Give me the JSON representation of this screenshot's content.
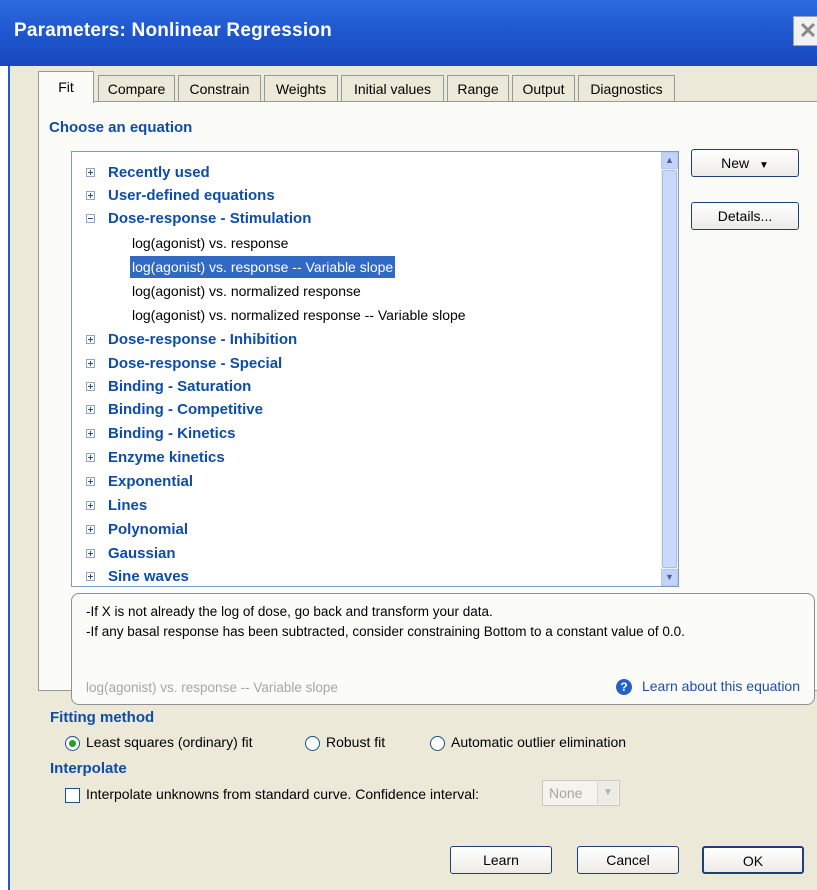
{
  "window": {
    "title": "Parameters: Nonlinear Regression",
    "close_icon": "close-icon"
  },
  "tabs": [
    "Fit",
    "Compare",
    "Constrain",
    "Weights",
    "Initial values",
    "Range",
    "Output",
    "Diagnostics"
  ],
  "choose_equation": {
    "heading": "Choose an equation"
  },
  "tree": {
    "categories_top": [
      {
        "label": "Recently used",
        "expanded": false
      },
      {
        "label": "User-defined equations",
        "expanded": false
      },
      {
        "label": "Dose-response - Stimulation",
        "expanded": true
      }
    ],
    "children": [
      {
        "label": "log(agonist) vs. response",
        "selected": false
      },
      {
        "label": "log(agonist) vs. response -- Variable slope",
        "selected": true
      },
      {
        "label": "log(agonist) vs. normalized response",
        "selected": false
      },
      {
        "label": "log(agonist) vs. normalized response -- Variable slope",
        "selected": false
      }
    ],
    "categories_bottom": [
      {
        "label": "Dose-response - Inhibition"
      },
      {
        "label": "Dose-response - Special"
      },
      {
        "label": "Binding - Saturation"
      },
      {
        "label": "Binding - Competitive"
      },
      {
        "label": "Binding - Kinetics"
      },
      {
        "label": "Enzyme kinetics"
      },
      {
        "label": "Exponential"
      },
      {
        "label": "Lines"
      },
      {
        "label": "Polynomial"
      },
      {
        "label": "Gaussian"
      },
      {
        "label": "Sine waves"
      }
    ]
  },
  "side_buttons": {
    "new": "New",
    "details": "Details..."
  },
  "description": {
    "line1": "-If X is not already the log of dose, go back and transform your data.",
    "line2": "-If any basal response has been subtracted, consider constraining Bottom to a constant value of 0.0.",
    "equation_name": "log(agonist) vs. response -- Variable slope",
    "learn_link": "Learn about this equation"
  },
  "fitting_method": {
    "heading": "Fitting method",
    "options": [
      {
        "label": "Least squares (ordinary) fit",
        "selected": true
      },
      {
        "label": "Robust fit",
        "selected": false
      },
      {
        "label": "Automatic outlier elimination",
        "selected": false
      }
    ]
  },
  "interpolate": {
    "heading": "Interpolate",
    "checkbox_label": "Interpolate unknowns from standard curve. Confidence interval:",
    "checked": false,
    "ci_value": "None"
  },
  "footer": {
    "learn": "Learn",
    "cancel": "Cancel",
    "ok": "OK"
  }
}
